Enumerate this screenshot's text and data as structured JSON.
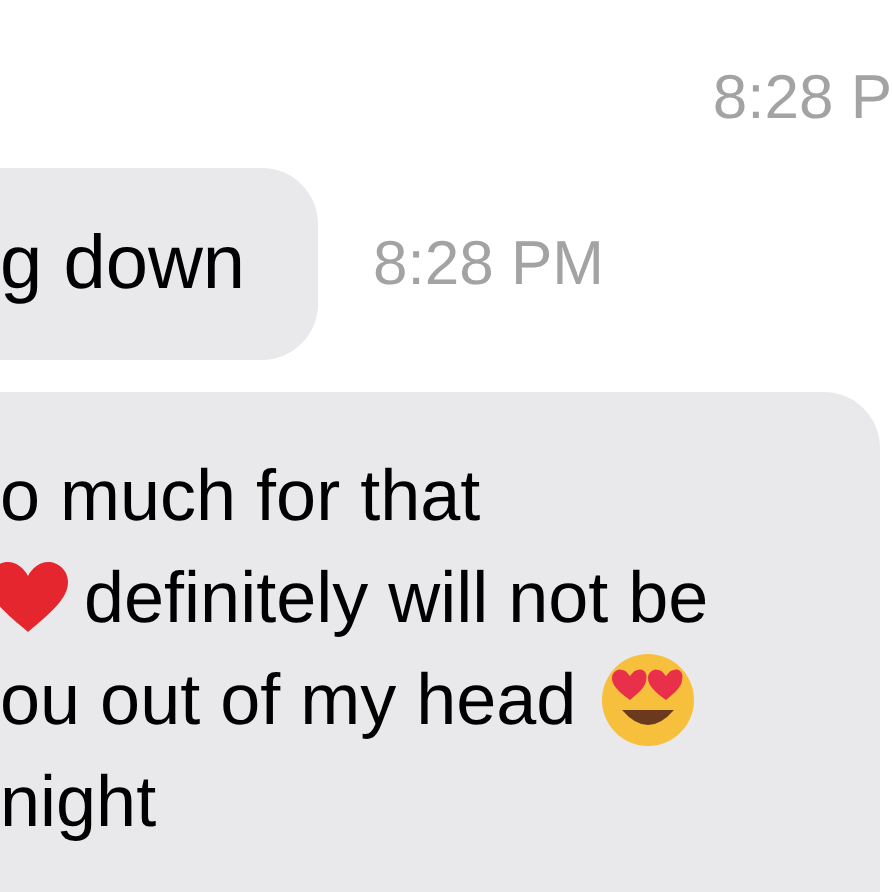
{
  "messages": [
    {
      "kind": "timestamp",
      "text": "8:28 P"
    },
    {
      "kind": "bubble",
      "time": "8:28 PM",
      "lines": [
        [
          {
            "kind": "text",
            "text": "g down"
          }
        ]
      ]
    },
    {
      "kind": "bubble",
      "lines": [
        [
          {
            "kind": "text",
            "text": "o much for that"
          }
        ],
        [
          {
            "kind": "heart"
          },
          {
            "kind": "text",
            "text": "definitely will not be"
          }
        ],
        [
          {
            "kind": "text",
            "text": "ou out of my head"
          },
          {
            "kind": "heart-eyes"
          }
        ],
        [
          {
            "kind": "text",
            "text": "night"
          }
        ]
      ]
    }
  ]
}
